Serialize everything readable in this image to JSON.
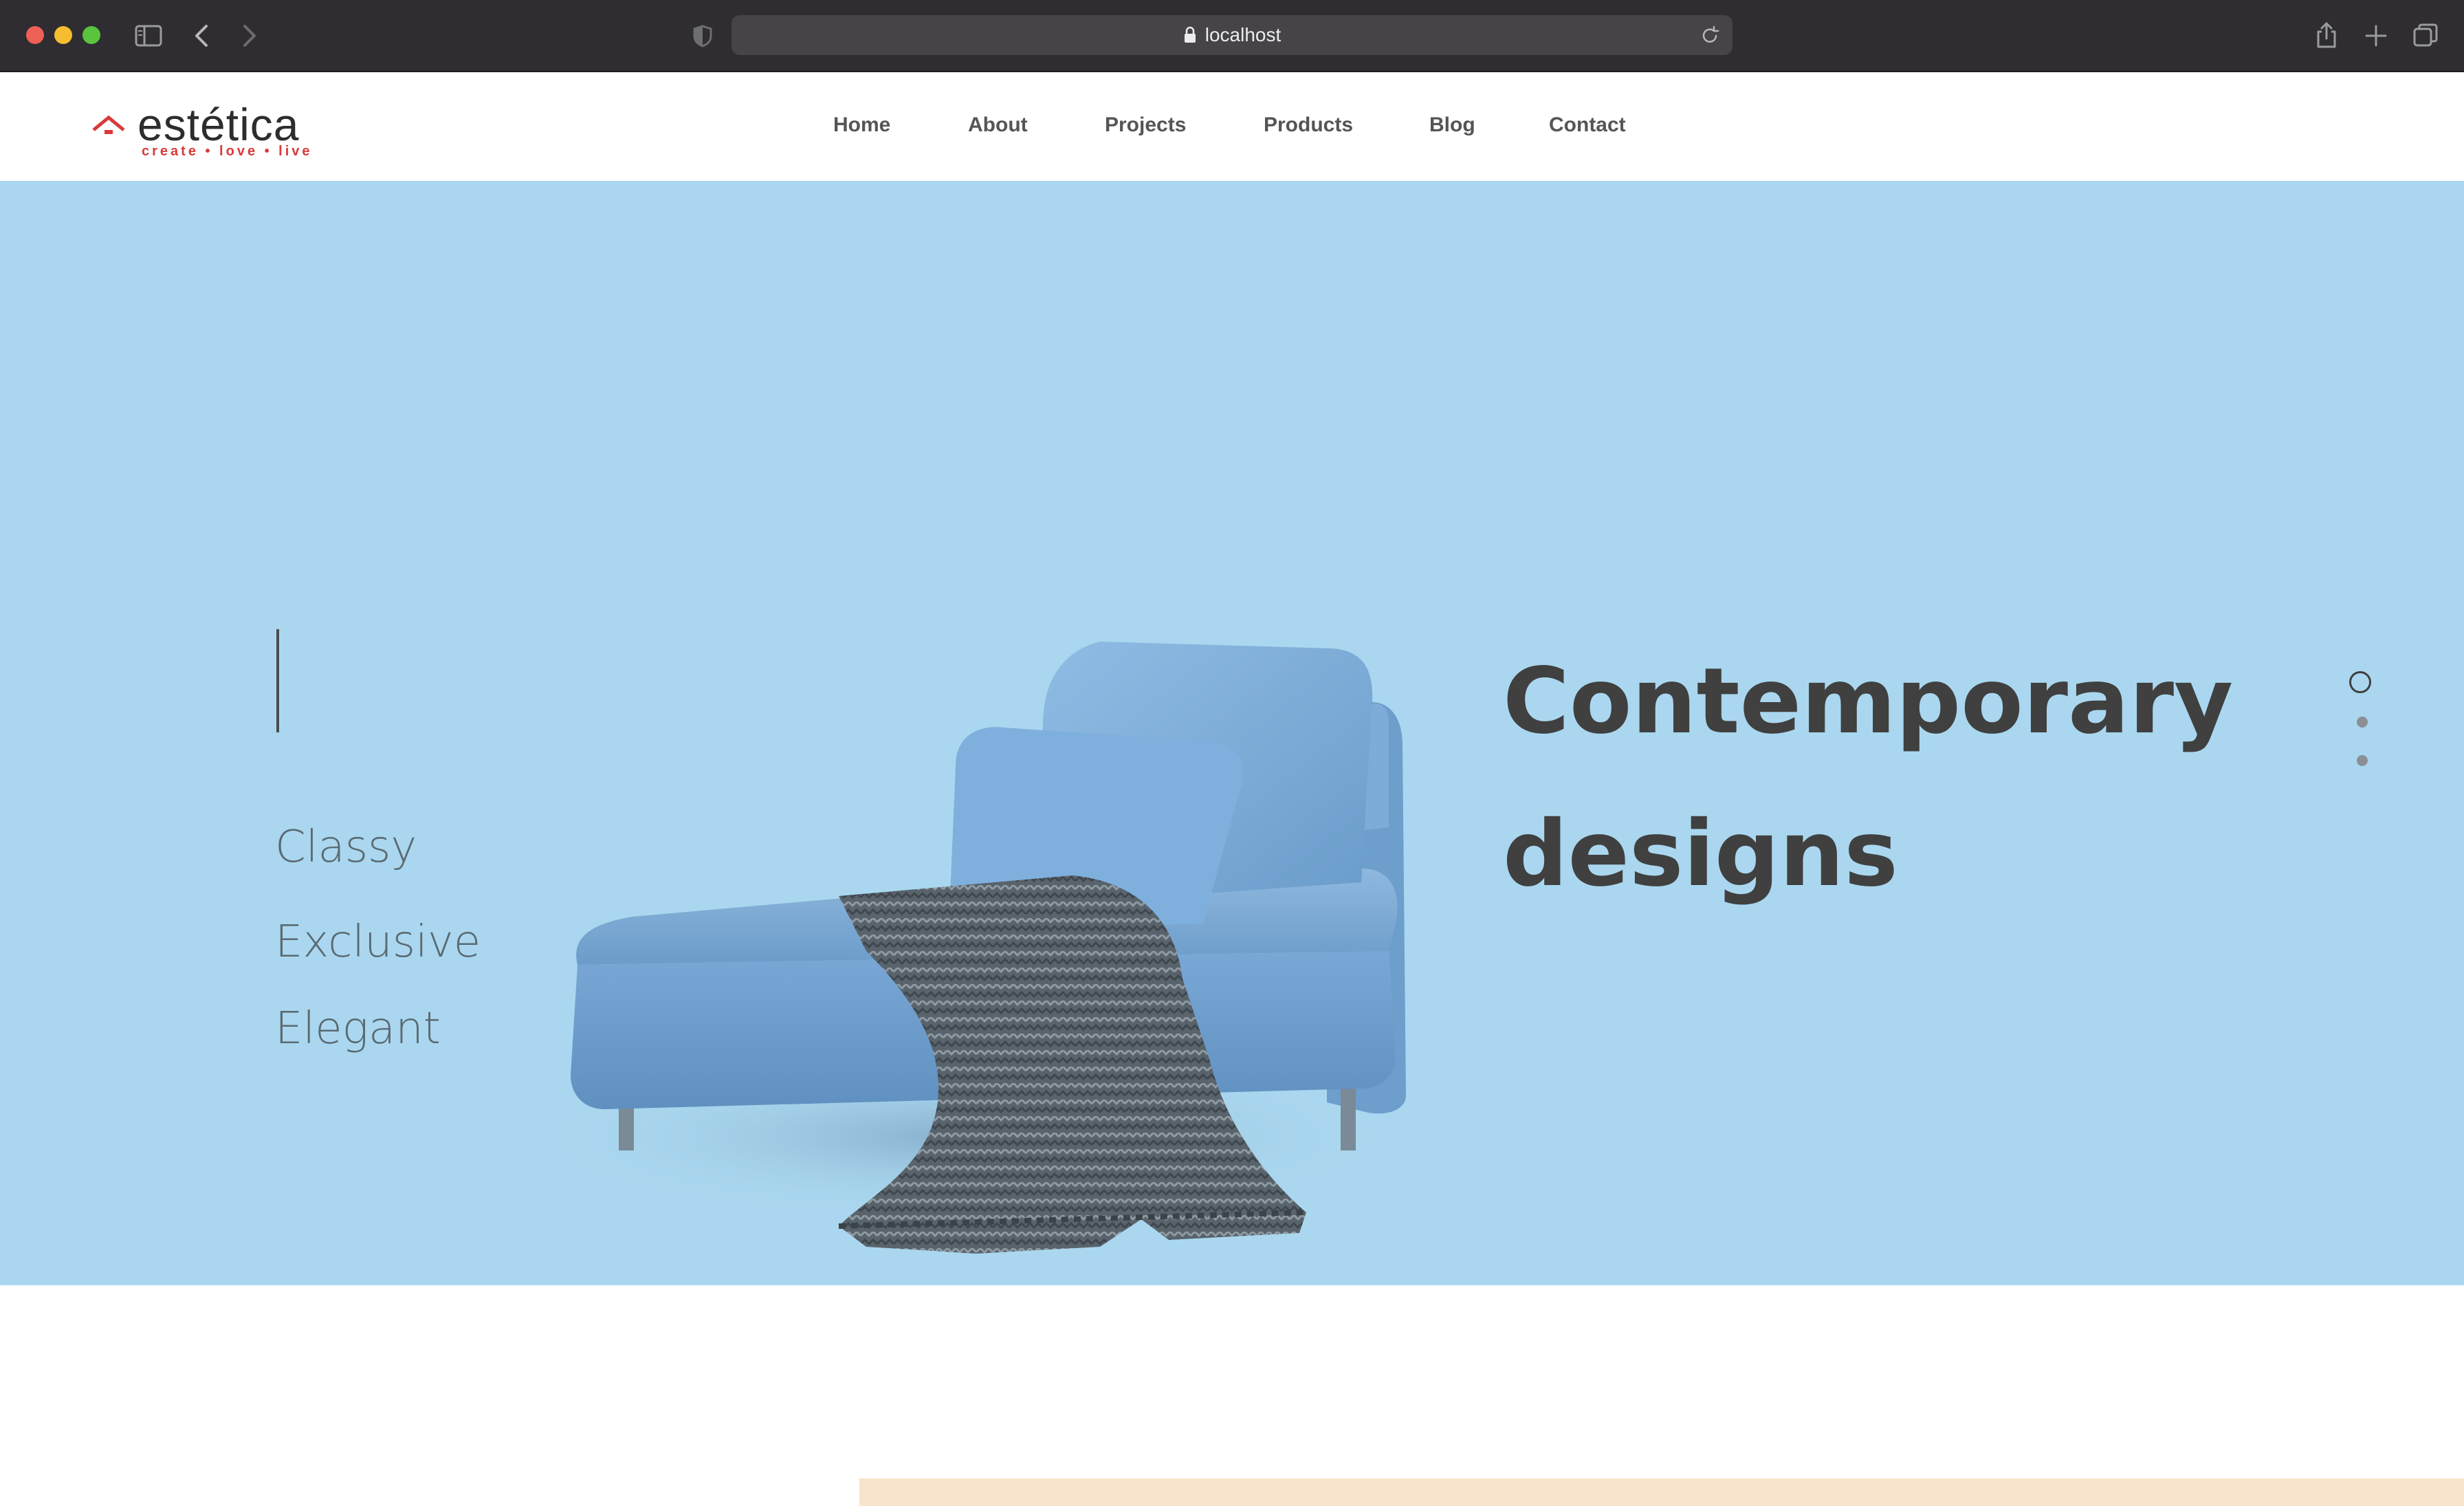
{
  "browser": {
    "url": "localhost"
  },
  "site": {
    "logo": {
      "name": "estética",
      "tagline": "create • love • live"
    },
    "nav": [
      {
        "label": "Home"
      },
      {
        "label": "About"
      },
      {
        "label": "Projects"
      },
      {
        "label": "Products"
      },
      {
        "label": "Blog"
      },
      {
        "label": "Contact"
      }
    ]
  },
  "hero": {
    "background_color": "#aad7ef",
    "features": [
      "Classy",
      "Exclusive",
      "Elegant"
    ],
    "headline_line1": "Contemporary",
    "headline_line2": "designs",
    "slide_current": "1",
    "slide_total": "3",
    "active_slide": 1,
    "slide_count": 3
  },
  "colors": {
    "brand_red": "#d83a3a",
    "text_dark": "#404040",
    "section_peach": "#f8e4cc"
  }
}
